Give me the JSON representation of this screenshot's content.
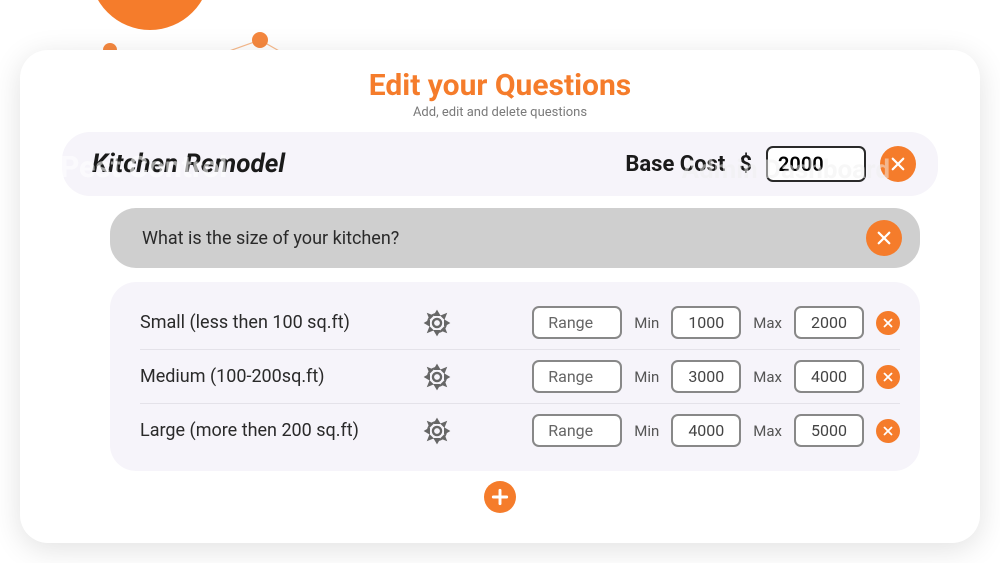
{
  "header": {
    "title": "Edit your Questions",
    "subtitle": "Add, edit and delete questions"
  },
  "background": {
    "text_left": "Pest Control",
    "text_right": "Admin Dashboard"
  },
  "service": {
    "name": "Kitchen Remodel",
    "base_cost_label": "Base Cost",
    "currency": "$",
    "base_cost": "2000"
  },
  "question": {
    "text": "What is the size of your kitchen?"
  },
  "ui": {
    "type_label": "Range",
    "min_label": "Min",
    "max_label": "Max"
  },
  "options": [
    {
      "label": "Small (less then 100 sq.ft)",
      "min": "1000",
      "max": "2000"
    },
    {
      "label": "Medium (100-200sq.ft)",
      "min": "3000",
      "max": "4000"
    },
    {
      "label": "Large (more then 200 sq.ft)",
      "min": "4000",
      "max": "5000"
    }
  ],
  "colors": {
    "accent": "#F57C2B",
    "panel": "#F6F4FA",
    "question_bg": "#CFCFCF"
  }
}
